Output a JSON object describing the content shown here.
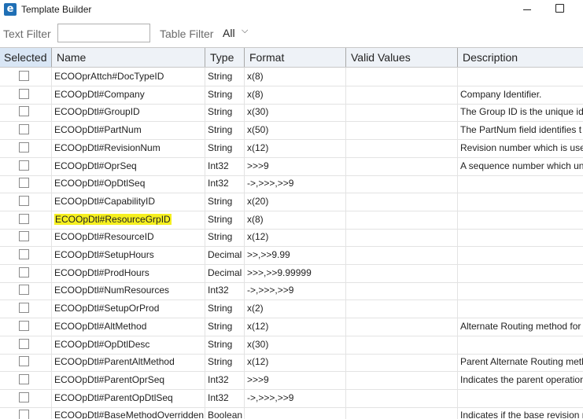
{
  "window": {
    "logo_letter": "e",
    "title": "Template Builder"
  },
  "filter": {
    "text_label": "Text Filter",
    "text_value": "",
    "table_label": "Table Filter",
    "table_value": "All"
  },
  "columns": [
    "Selected",
    "Name",
    "Type",
    "Format",
    "Valid Values",
    "Description"
  ],
  "rows": [
    {
      "name": "ECOOprAttch#DocTypeID",
      "type": "String",
      "format": "x(8)",
      "valid": "",
      "description": ""
    },
    {
      "name": "ECOOpDtl#Company",
      "type": "String",
      "format": "x(8)",
      "valid": "",
      "description": "Company Identifier."
    },
    {
      "name": "ECOOpDtl#GroupID",
      "type": "String",
      "format": "x(30)",
      "valid": "",
      "description": "The Group ID is the unique id"
    },
    {
      "name": "ECOOpDtl#PartNum",
      "type": "String",
      "format": "x(50)",
      "valid": "",
      "description": "The PartNum field identifies t"
    },
    {
      "name": "ECOOpDtl#RevisionNum",
      "type": "String",
      "format": "x(12)",
      "valid": "",
      "description": "Revision number which is use"
    },
    {
      "name": "ECOOpDtl#OprSeq",
      "type": "Int32",
      "format": ">>>9",
      "valid": "",
      "description": "A sequence number which un"
    },
    {
      "name": "ECOOpDtl#OpDtlSeq",
      "type": "Int32",
      "format": "->,>>>,>>9",
      "valid": "",
      "description": ""
    },
    {
      "name": "ECOOpDtl#CapabilityID",
      "type": "String",
      "format": "x(20)",
      "valid": "",
      "description": ""
    },
    {
      "name": "ECOOpDtl#ResourceGrpID",
      "type": "String",
      "format": "x(8)",
      "valid": "",
      "description": "",
      "highlight": true
    },
    {
      "name": "ECOOpDtl#ResourceID",
      "type": "String",
      "format": "x(12)",
      "valid": "",
      "description": ""
    },
    {
      "name": "ECOOpDtl#SetupHours",
      "type": "Decimal",
      "format": ">>,>>9.99",
      "valid": "",
      "description": ""
    },
    {
      "name": "ECOOpDtl#ProdHours",
      "type": "Decimal",
      "format": ">>>,>>9.99999",
      "valid": "",
      "description": ""
    },
    {
      "name": "ECOOpDtl#NumResources",
      "type": "Int32",
      "format": "->,>>>,>>9",
      "valid": "",
      "description": ""
    },
    {
      "name": "ECOOpDtl#SetupOrProd",
      "type": "String",
      "format": "x(2)",
      "valid": "",
      "description": ""
    },
    {
      "name": "ECOOpDtl#AltMethod",
      "type": "String",
      "format": "x(12)",
      "valid": "",
      "description": "Alternate Routing method for"
    },
    {
      "name": "ECOOpDtl#OpDtlDesc",
      "type": "String",
      "format": "x(30)",
      "valid": "",
      "description": ""
    },
    {
      "name": "ECOOpDtl#ParentAltMethod",
      "type": "String",
      "format": "x(12)",
      "valid": "",
      "description": "Parent Alternate Routing meth"
    },
    {
      "name": "ECOOpDtl#ParentOprSeq",
      "type": "Int32",
      "format": ">>>9",
      "valid": "",
      "description": "Indicates the parent operation"
    },
    {
      "name": "ECOOpDtl#ParentOpDtlSeq",
      "type": "Int32",
      "format": "->,>>>,>>9",
      "valid": "",
      "description": ""
    },
    {
      "name": "ECOOpDtl#BaseMethodOverridden",
      "type": "Boolean",
      "format": "",
      "valid": "",
      "description": "Indicates if the base revision r"
    }
  ],
  "colors": {
    "header_bg": "#eef2f7",
    "selected_header_bg": "#d9e6f5",
    "highlight": "#f6f020",
    "logo": "#1f6fb5"
  }
}
